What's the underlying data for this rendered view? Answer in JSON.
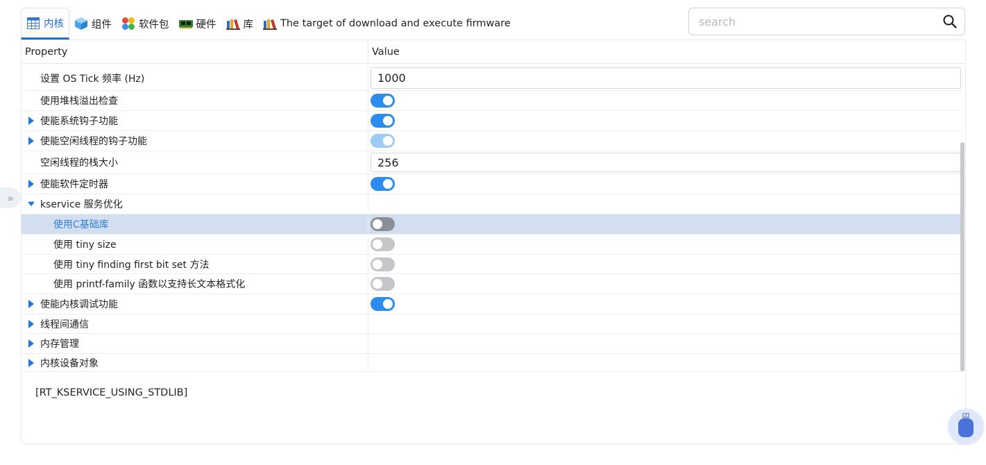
{
  "tabs": [
    {
      "label": "内核",
      "icon": "table-icon",
      "active": true
    },
    {
      "label": "组件",
      "icon": "cube-icon"
    },
    {
      "label": "软件包",
      "icon": "packages-icon"
    },
    {
      "label": "硬件",
      "icon": "board-icon"
    },
    {
      "label": "库",
      "icon": "books-icon"
    },
    {
      "label": "The target of download and execute firmware",
      "icon": "books-icon"
    }
  ],
  "search": {
    "placeholder": "search",
    "value": ""
  },
  "table": {
    "header": {
      "property": "Property",
      "value": "Value"
    },
    "rows": [
      {
        "label": "设置 OS Tick 频率 (Hz)",
        "value": "1000"
      },
      {
        "label": "使用堆栈溢出检查",
        "toggle": "on"
      },
      {
        "label": "使能系统钩子功能",
        "toggle": "on",
        "expander": "collapsed"
      },
      {
        "label": "使能空闲线程的钩子功能",
        "toggle": "on-disabled",
        "expander": "collapsed"
      },
      {
        "label": "空闲线程的栈大小",
        "value": "256"
      },
      {
        "label": "使能软件定时器",
        "toggle": "on",
        "expander": "collapsed"
      },
      {
        "label": "kservice 服务优化",
        "expander": "expanded"
      },
      {
        "label": "使用C基础库",
        "toggle": "off",
        "selected": true
      },
      {
        "label": "使用 tiny size",
        "toggle": "off"
      },
      {
        "label": "使用 tiny finding first bit set 方法",
        "toggle": "off"
      },
      {
        "label": "使用 printf-family 函数以支持长文本格式化",
        "toggle": "off"
      },
      {
        "label": "使能内核调试功能",
        "toggle": "on",
        "expander": "collapsed"
      },
      {
        "label": "线程间通信",
        "expander": "collapsed"
      },
      {
        "label": "内存管理",
        "expander": "collapsed"
      },
      {
        "label": "内核设备对象",
        "expander": "collapsed"
      }
    ]
  },
  "description": "[RT_KSERVICE_USING_STDLIB]",
  "side_handle": "»",
  "colors": {
    "accent": "#2d8cf0",
    "selected_row": "#d3dff0",
    "caret": "#1e78e0"
  }
}
